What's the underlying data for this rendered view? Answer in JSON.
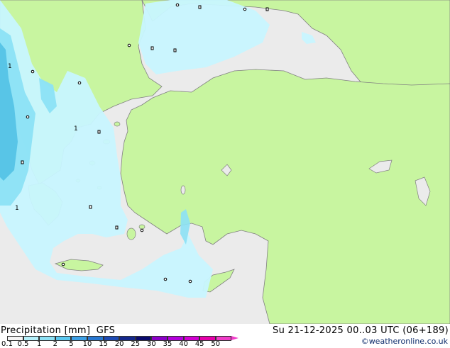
{
  "footer": {
    "product": "Precipitation [mm]",
    "model": "GFS",
    "datetime": "Su 21-12-2025 00..03 UTC (06+189)",
    "credit": "©weatheronline.co.uk"
  },
  "legend": {
    "ticks": [
      "0.1",
      "0.5",
      "1",
      "2",
      "5",
      "10",
      "15",
      "20",
      "25",
      "30",
      "35",
      "40",
      "45",
      "50"
    ],
    "colors": [
      "#f5f5f5",
      "#b4f0fa",
      "#8ce1f5",
      "#5ac8f0",
      "#3ca0e6",
      "#2878d2",
      "#1e4bb4",
      "#14288c",
      "#0a0a6e",
      "#8c00c8",
      "#b400dc",
      "#d200d2",
      "#e600aa",
      "#f03cc8"
    ]
  },
  "map": {
    "colors": {
      "land": "#c8f5a0",
      "sea": "#ebebeb",
      "precip_light": "#c8f5ff",
      "precip_med": "#8ce1f5",
      "precip_heavy": "#55c3e6",
      "border": "#808080"
    },
    "labels": [
      "1",
      "1",
      "1"
    ]
  }
}
